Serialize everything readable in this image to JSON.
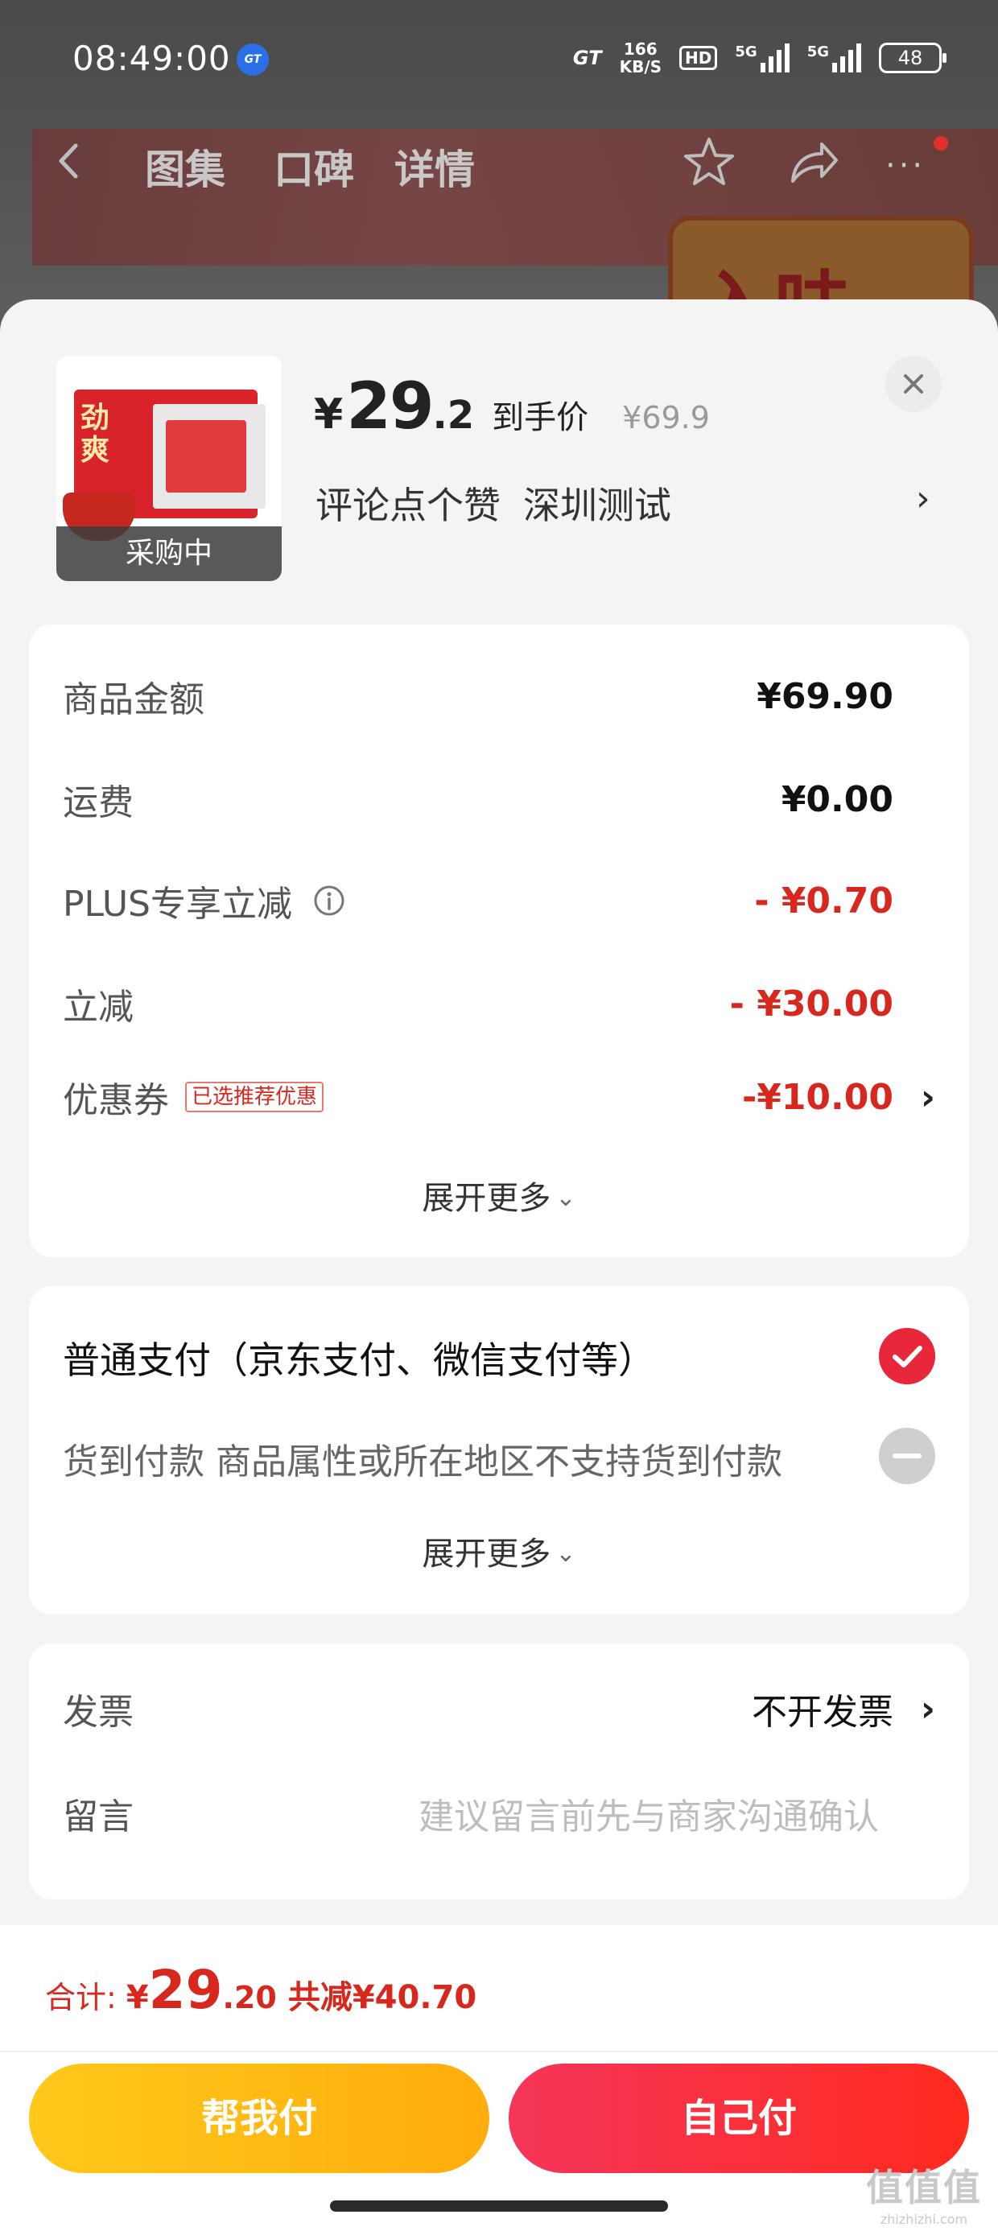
{
  "status_bar": {
    "time": "08:49:00",
    "gt_badge": "GT",
    "gt_label": "GT",
    "net_speed_value": "166",
    "net_speed_unit": "KB/S",
    "hd_label": "HD",
    "sig1_label": "5G",
    "sig2_label": "5G",
    "battery": "48"
  },
  "nav": {
    "tabs": [
      "图集",
      "口碑",
      "详情"
    ],
    "more": "···"
  },
  "background": {
    "banner_text": "入味"
  },
  "product": {
    "thumb_text": "劲爽",
    "badge": "采购中",
    "price_currency": "¥",
    "price_int": "29",
    "price_dec": ".2",
    "price_label": "到手价",
    "original_price": "¥69.9",
    "subtitle_a": "评论点个赞",
    "subtitle_b": "深圳测试",
    "arrow": "›"
  },
  "summary": {
    "rows": [
      {
        "label": "商品金额",
        "value": "¥69.90"
      },
      {
        "label": "运费",
        "value": "¥0.00"
      },
      {
        "label": "PLUS专享立减",
        "value": "- ¥0.70"
      },
      {
        "label": "立减",
        "value": "- ¥30.00"
      },
      {
        "label": "优惠券",
        "value": "-¥10.00",
        "tag": "已选推荐优惠"
      }
    ],
    "expand": "展开更多",
    "chevron": "⌄"
  },
  "payment": {
    "main": "普通支付（京东支付、微信支付等）",
    "cod": "货到付款 商品属性或所在地区不支持货到付款",
    "expand": "展开更多",
    "chevron": "⌄"
  },
  "extra": {
    "invoice_label": "发票",
    "invoice_value": "不开发票",
    "note_label": "留言",
    "note_placeholder": "建议留言前先与商家沟通确认",
    "arrow": "›"
  },
  "footer": {
    "total_label": "合计:",
    "total_currency": "¥",
    "total_int": "29",
    "total_dec": ".20",
    "saved": "共减¥40.70",
    "btn_help": "帮我付",
    "btn_self": "自己付"
  },
  "watermark": {
    "big": "值值值",
    "small": "zhizhizhi.com"
  },
  "colors": {
    "accent_red": "#d8281e",
    "button_yellow": "#ffb80f",
    "button_red": "#f5365a"
  }
}
